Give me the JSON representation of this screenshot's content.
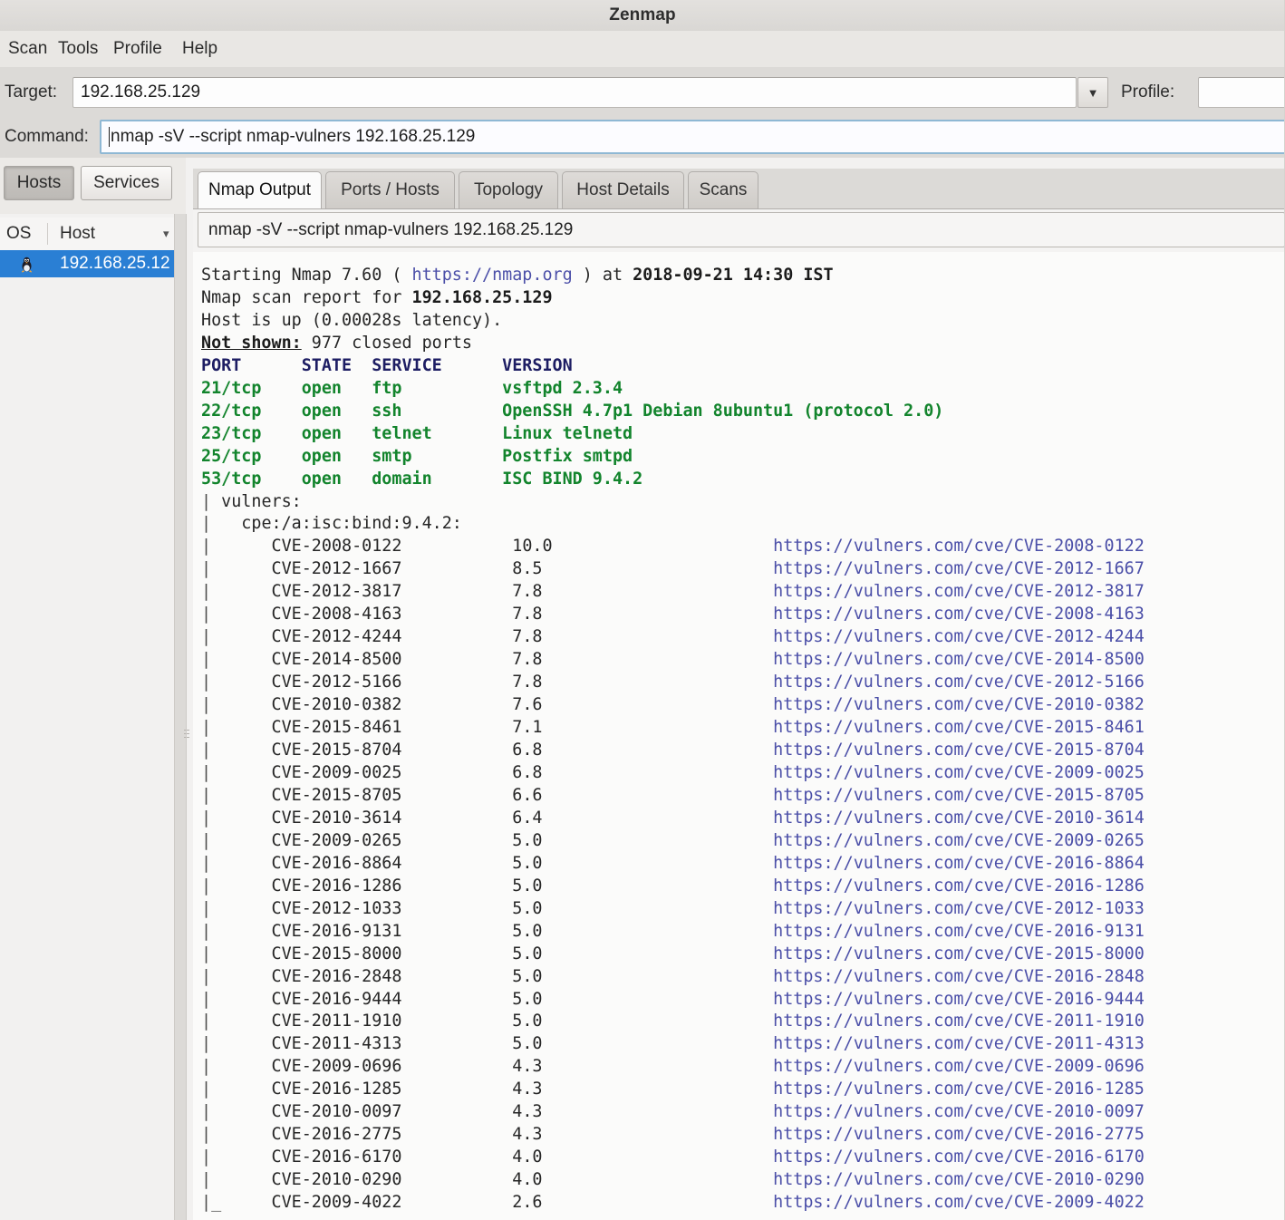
{
  "window": {
    "title": "Zenmap"
  },
  "menubar": {
    "items": [
      "Scan",
      "Tools",
      "Profile",
      "Help"
    ]
  },
  "toolbar": {
    "target_label": "Target:",
    "target_value": "192.168.25.129",
    "target_dropdown_glyph": "▼",
    "profile_label": "Profile:",
    "profile_value": "",
    "command_label": "Command:",
    "command_value": "nmap -sV --script nmap-vulners 192.168.25.129"
  },
  "left_pane": {
    "hosts_button": "Hosts",
    "services_button": "Services",
    "columns": [
      "OS",
      "Host"
    ],
    "sort_glyph": "▾",
    "rows": [
      {
        "os_icon": "linux-penguin-icon",
        "host": "192.168.25.12"
      }
    ]
  },
  "tabs": [
    {
      "label": "Nmap Output",
      "active": true
    },
    {
      "label": "Ports / Hosts",
      "active": false
    },
    {
      "label": "Topology",
      "active": false
    },
    {
      "label": "Host Details",
      "active": false
    },
    {
      "label": "Scans",
      "active": false
    }
  ],
  "command_display": "nmap -sV --script nmap-vulners 192.168.25.129",
  "colors": {
    "link": "#4b4fa8",
    "port_open": "#12842c",
    "table_header": "#1d1d63",
    "selection": "#2a7fd4",
    "chrome": "#dcdad7",
    "output_bg": "#fbfbfa"
  },
  "output": {
    "starting_prefix": "Starting Nmap 7.60 ( ",
    "nmap_url": "https://nmap.org",
    "starting_mid": " ) at ",
    "scan_datetime": "2018-09-21 14:30 IST",
    "report_prefix": "Nmap scan report for ",
    "report_host": "192.168.25.129",
    "host_up": "Host is up (0.00028s latency).",
    "not_shown_label": "Not shown:",
    "not_shown_rest": " 977 closed ports",
    "port_table_header": {
      "port": "PORT",
      "state": "STATE",
      "service": "SERVICE",
      "version": "VERSION"
    },
    "ports": [
      {
        "port": "21/tcp",
        "state": "open",
        "service": "ftp",
        "version": "vsftpd 2.3.4"
      },
      {
        "port": "22/tcp",
        "state": "open",
        "service": "ssh",
        "version": "OpenSSH 4.7p1 Debian 8ubuntu1 (protocol 2.0)"
      },
      {
        "port": "23/tcp",
        "state": "open",
        "service": "telnet",
        "version": "Linux telnetd"
      },
      {
        "port": "25/tcp",
        "state": "open",
        "service": "smtp",
        "version": "Postfix smtpd"
      },
      {
        "port": "53/tcp",
        "state": "open",
        "service": "domain",
        "version": "ISC BIND 9.4.2"
      }
    ],
    "script_name": "vulners:",
    "cpe": "cpe:/a:isc:bind:9.4.2:",
    "url_base": "https://vulners.com/cve/",
    "vulns": [
      {
        "cve": "CVE-2008-0122",
        "score": "10.0"
      },
      {
        "cve": "CVE-2012-1667",
        "score": "8.5"
      },
      {
        "cve": "CVE-2012-3817",
        "score": "7.8"
      },
      {
        "cve": "CVE-2008-4163",
        "score": "7.8"
      },
      {
        "cve": "CVE-2012-4244",
        "score": "7.8"
      },
      {
        "cve": "CVE-2014-8500",
        "score": "7.8"
      },
      {
        "cve": "CVE-2012-5166",
        "score": "7.8"
      },
      {
        "cve": "CVE-2010-0382",
        "score": "7.6"
      },
      {
        "cve": "CVE-2015-8461",
        "score": "7.1"
      },
      {
        "cve": "CVE-2015-8704",
        "score": "6.8"
      },
      {
        "cve": "CVE-2009-0025",
        "score": "6.8"
      },
      {
        "cve": "CVE-2015-8705",
        "score": "6.6"
      },
      {
        "cve": "CVE-2010-3614",
        "score": "6.4"
      },
      {
        "cve": "CVE-2009-0265",
        "score": "5.0"
      },
      {
        "cve": "CVE-2016-8864",
        "score": "5.0"
      },
      {
        "cve": "CVE-2016-1286",
        "score": "5.0"
      },
      {
        "cve": "CVE-2012-1033",
        "score": "5.0"
      },
      {
        "cve": "CVE-2016-9131",
        "score": "5.0"
      },
      {
        "cve": "CVE-2015-8000",
        "score": "5.0"
      },
      {
        "cve": "CVE-2016-2848",
        "score": "5.0"
      },
      {
        "cve": "CVE-2016-9444",
        "score": "5.0"
      },
      {
        "cve": "CVE-2011-1910",
        "score": "5.0"
      },
      {
        "cve": "CVE-2011-4313",
        "score": "5.0"
      },
      {
        "cve": "CVE-2009-0696",
        "score": "4.3"
      },
      {
        "cve": "CVE-2016-1285",
        "score": "4.3"
      },
      {
        "cve": "CVE-2010-0097",
        "score": "4.3"
      },
      {
        "cve": "CVE-2016-2775",
        "score": "4.3"
      },
      {
        "cve": "CVE-2016-6170",
        "score": "4.0"
      },
      {
        "cve": "CVE-2010-0290",
        "score": "4.0"
      },
      {
        "cve": "CVE-2009-4022",
        "score": "2.6"
      }
    ]
  }
}
